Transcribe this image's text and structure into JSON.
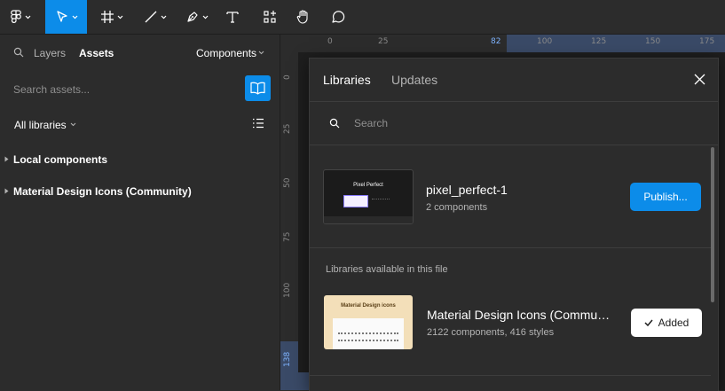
{
  "toolbar": {
    "tools": [
      "main-menu",
      "move",
      "frame",
      "line",
      "pen",
      "text",
      "resources",
      "hand",
      "comment"
    ]
  },
  "left_panel": {
    "tab_layers": "Layers",
    "tab_assets": "Assets",
    "components_dropdown": "Components",
    "search_placeholder": "Search assets...",
    "filter": "All libraries",
    "sections": [
      "Local components",
      "Material Design Icons (Community)"
    ]
  },
  "rulers": {
    "top": [
      "0",
      "25",
      "82",
      "100",
      "125",
      "150",
      "175"
    ],
    "left": [
      "0",
      "25",
      "50",
      "75",
      "100",
      "138"
    ]
  },
  "modal": {
    "tab_libraries": "Libraries",
    "tab_updates": "Updates",
    "search_placeholder": "Search",
    "current_file": {
      "name": "pixel_perfect-1",
      "meta": "2 components",
      "thumb_title": "Pixel Perfect",
      "action": "Publish..."
    },
    "section_label": "Libraries available in this file",
    "libraries": [
      {
        "name": "Material Design Icons (Commu…",
        "meta": "2122 components, 416 styles",
        "thumb_title": "Material Design icons",
        "action": "Added"
      }
    ]
  },
  "colors": {
    "accent": "#0c8ce9",
    "panel": "#2c2c2c",
    "canvas": "#1e1e1e",
    "ruler_highlight": "#3a4a67"
  }
}
